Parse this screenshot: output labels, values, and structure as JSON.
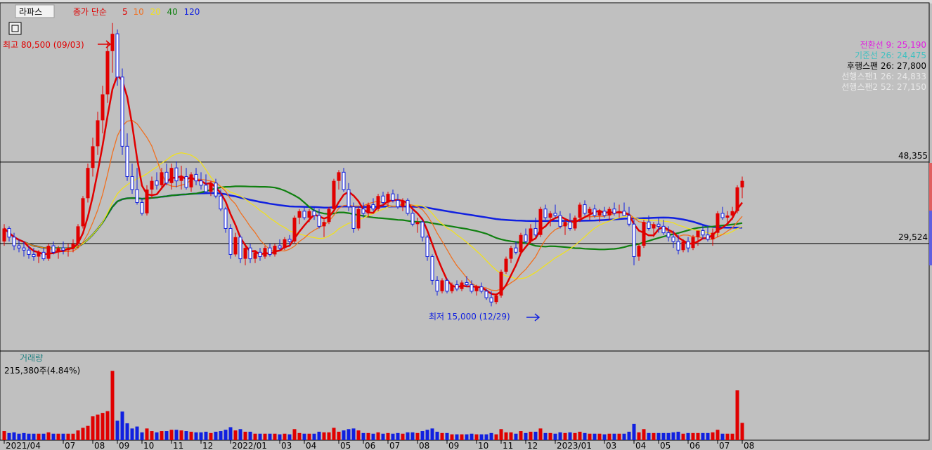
{
  "header": {
    "stock_name": "라파스",
    "ma_prefix": "종가 단순",
    "ma_periods": [
      {
        "period": "5",
        "color": "#e00000"
      },
      {
        "period": "10",
        "color": "#f07020"
      },
      {
        "period": "20",
        "color": "#f0e020"
      },
      {
        "period": "40",
        "color": "#108010"
      },
      {
        "period": "120",
        "color": "#1020e0"
      }
    ]
  },
  "ichimoku": [
    {
      "label": "전환선 9: 25,190",
      "color": "#e020e0"
    },
    {
      "label": "기준선 26: 24,475",
      "color": "#40c0c0"
    },
    {
      "label": "후행스팬 26: 27,800",
      "color": "#000000"
    },
    {
      "label": "선행스팬1 26: 24,833",
      "color": "#e8e8e8"
    },
    {
      "label": "선행스팬2 52: 27,150",
      "color": "#e8e8e8"
    }
  ],
  "annotations": {
    "high_label": "최고 80,500 (09/03)",
    "low_label": "최저 15,000 (12/29)"
  },
  "volume": {
    "title": "거래량",
    "value": "215,380주(4.84%)"
  },
  "colors": {
    "up": "#e00000",
    "down": "#1020e0",
    "background": "#c0c0c0"
  },
  "chart_data": {
    "type": "candlestick",
    "price_ylim": [
      5000,
      85000
    ],
    "horizontal_lines": [
      {
        "value": 48355,
        "label": "48,355"
      },
      {
        "value": 29524,
        "label": "29,524"
      }
    ],
    "x_tick_labels": [
      {
        "index": 0,
        "label": "2021/04"
      },
      {
        "index": 12,
        "label": "07"
      },
      {
        "index": 18,
        "label": "08"
      },
      {
        "index": 23,
        "label": "09"
      },
      {
        "index": 28,
        "label": "10"
      },
      {
        "index": 34,
        "label": "11"
      },
      {
        "index": 40,
        "label": "12"
      },
      {
        "index": 46,
        "label": "2022/01"
      },
      {
        "index": 56,
        "label": "03"
      },
      {
        "index": 61,
        "label": "04"
      },
      {
        "index": 68,
        "label": "05"
      },
      {
        "index": 73,
        "label": "06"
      },
      {
        "index": 78,
        "label": "07"
      },
      {
        "index": 84,
        "label": "08"
      },
      {
        "index": 90,
        "label": "09"
      },
      {
        "index": 96,
        "label": "10"
      },
      {
        "index": 101,
        "label": "11"
      },
      {
        "index": 106,
        "label": "12"
      },
      {
        "index": 112,
        "label": "2023/01"
      },
      {
        "index": 122,
        "label": "03"
      },
      {
        "index": 128,
        "label": "04"
      },
      {
        "index": 133,
        "label": "05"
      },
      {
        "index": 139,
        "label": "06"
      },
      {
        "index": 145,
        "label": "07"
      },
      {
        "index": 150,
        "label": "08"
      }
    ],
    "candles": [
      [
        30000,
        34000,
        29000,
        33000
      ],
      [
        33000,
        33500,
        30000,
        31000
      ],
      [
        31000,
        32000,
        28000,
        29000
      ],
      [
        29000,
        30500,
        27500,
        28500
      ],
      [
        28500,
        30000,
        26500,
        28000
      ],
      [
        28000,
        29000,
        26000,
        27000
      ],
      [
        27000,
        28500,
        25500,
        26500
      ],
      [
        26500,
        28000,
        25000,
        27500
      ],
      [
        27500,
        28500,
        25500,
        26000
      ],
      [
        26000,
        29500,
        25500,
        29000
      ],
      [
        29000,
        30000,
        27000,
        27500
      ],
      [
        27500,
        29000,
        26000,
        28500
      ],
      [
        28500,
        30000,
        27000,
        28000
      ],
      [
        28000,
        29500,
        26500,
        28500
      ],
      [
        28500,
        30500,
        27500,
        29500
      ],
      [
        29500,
        34000,
        28500,
        33500
      ],
      [
        33500,
        40500,
        33000,
        40000
      ],
      [
        40000,
        48000,
        39000,
        47000
      ],
      [
        47000,
        54000,
        45000,
        52000
      ],
      [
        52000,
        60000,
        50000,
        58000
      ],
      [
        58000,
        66000,
        55000,
        64000
      ],
      [
        64000,
        76000,
        62000,
        74000
      ],
      [
        74000,
        80500,
        69000,
        78000
      ],
      [
        78000,
        79000,
        66000,
        68000
      ],
      [
        68000,
        70000,
        50000,
        52000
      ],
      [
        52000,
        55000,
        44000,
        45000
      ],
      [
        45000,
        48000,
        41000,
        42000
      ],
      [
        42000,
        47000,
        38500,
        39000
      ],
      [
        39000,
        40000,
        36000,
        36500
      ],
      [
        36500,
        43000,
        36000,
        42000
      ],
      [
        42000,
        45000,
        40000,
        44000
      ],
      [
        44000,
        46000,
        42000,
        43000
      ],
      [
        43000,
        47000,
        42000,
        46000
      ],
      [
        46000,
        48000,
        43000,
        43500
      ],
      [
        43500,
        48000,
        42000,
        47000
      ],
      [
        47000,
        48500,
        42500,
        44000
      ],
      [
        44000,
        47500,
        42000,
        45000
      ],
      [
        45000,
        47000,
        42000,
        42500
      ],
      [
        42500,
        46000,
        41500,
        45500
      ],
      [
        45500,
        47000,
        43000,
        44000
      ],
      [
        44000,
        46000,
        42000,
        43000
      ],
      [
        43000,
        45500,
        41000,
        41500
      ],
      [
        41500,
        44000,
        40500,
        43500
      ],
      [
        43500,
        44500,
        40000,
        40500
      ],
      [
        40500,
        42000,
        37000,
        37500
      ],
      [
        37500,
        38000,
        32000,
        33000
      ],
      [
        33000,
        34000,
        26000,
        27000
      ],
      [
        27000,
        32000,
        26500,
        31000
      ],
      [
        31000,
        31500,
        25000,
        26000
      ],
      [
        26000,
        29000,
        24500,
        28500
      ],
      [
        28500,
        29500,
        25000,
        26000
      ],
      [
        26000,
        28000,
        25000,
        27500
      ],
      [
        27500,
        28500,
        25500,
        26500
      ],
      [
        26500,
        29000,
        26000,
        28500
      ],
      [
        28500,
        29500,
        26500,
        27000
      ],
      [
        27000,
        29500,
        26500,
        29000
      ],
      [
        29000,
        30500,
        28000,
        28500
      ],
      [
        28500,
        31000,
        28000,
        30500
      ],
      [
        30500,
        31500,
        29000,
        30000
      ],
      [
        30000,
        36000,
        29500,
        35500
      ],
      [
        35500,
        37500,
        34000,
        37000
      ],
      [
        37000,
        38000,
        35000,
        35500
      ],
      [
        35500,
        37500,
        34500,
        37000
      ],
      [
        37000,
        38000,
        35000,
        36000
      ],
      [
        36000,
        37500,
        33000,
        33500
      ],
      [
        33500,
        35000,
        31000,
        34500
      ],
      [
        34500,
        38000,
        34000,
        37500
      ],
      [
        37500,
        44500,
        37000,
        44000
      ],
      [
        44000,
        46500,
        42000,
        46000
      ],
      [
        46000,
        47000,
        41500,
        42000
      ],
      [
        42000,
        43500,
        37000,
        38000
      ],
      [
        38000,
        39000,
        32000,
        33000
      ],
      [
        33000,
        38000,
        32500,
        37500
      ],
      [
        37500,
        39000,
        35500,
        36500
      ],
      [
        36500,
        39000,
        35500,
        38500
      ],
      [
        38500,
        40000,
        37000,
        37500
      ],
      [
        37500,
        41000,
        37000,
        40500
      ],
      [
        40500,
        41500,
        38500,
        39000
      ],
      [
        39000,
        41500,
        38000,
        41000
      ],
      [
        41000,
        42000,
        39000,
        39500
      ],
      [
        39500,
        41000,
        37500,
        38000
      ],
      [
        38000,
        40000,
        37000,
        39500
      ],
      [
        39500,
        40000,
        36000,
        36500
      ],
      [
        36500,
        37500,
        33500,
        34000
      ],
      [
        34000,
        35500,
        32000,
        34500
      ],
      [
        34500,
        35000,
        30000,
        31000
      ],
      [
        31000,
        31500,
        25500,
        26500
      ],
      [
        26500,
        27000,
        20000,
        21000
      ],
      [
        21000,
        22000,
        17500,
        18500
      ],
      [
        18500,
        21500,
        18000,
        21000
      ],
      [
        21000,
        21500,
        18000,
        18500
      ],
      [
        18500,
        20500,
        18000,
        20000
      ],
      [
        20000,
        21000,
        18500,
        19000
      ],
      [
        19000,
        21000,
        18500,
        20500
      ],
      [
        20500,
        22000,
        19500,
        20000
      ],
      [
        20000,
        21000,
        18000,
        18500
      ],
      [
        18500,
        20000,
        17500,
        19500
      ],
      [
        19500,
        20500,
        18000,
        18500
      ],
      [
        18500,
        19000,
        16500,
        17000
      ],
      [
        17000,
        18500,
        15000,
        16000
      ],
      [
        16000,
        18000,
        15500,
        17500
      ],
      [
        17500,
        23500,
        17000,
        23000
      ],
      [
        23000,
        26500,
        22500,
        26000
      ],
      [
        26000,
        29000,
        25000,
        28500
      ],
      [
        28500,
        30000,
        27000,
        27500
      ],
      [
        27500,
        32000,
        27000,
        31500
      ],
      [
        31500,
        33000,
        29500,
        30000
      ],
      [
        30000,
        34000,
        29500,
        33000
      ],
      [
        33000,
        35500,
        31000,
        31500
      ],
      [
        31500,
        38000,
        31000,
        37500
      ],
      [
        37500,
        38500,
        35000,
        35500
      ],
      [
        35500,
        37000,
        33500,
        36500
      ],
      [
        36500,
        38500,
        35500,
        36000
      ],
      [
        36000,
        37000,
        33000,
        33500
      ],
      [
        33500,
        35000,
        31500,
        34500
      ],
      [
        34500,
        36500,
        32500,
        33000
      ],
      [
        33000,
        36000,
        32500,
        35500
      ],
      [
        35500,
        39000,
        34500,
        38500
      ],
      [
        38500,
        39500,
        36000,
        36500
      ],
      [
        36500,
        38000,
        35000,
        37500
      ],
      [
        37500,
        38500,
        35500,
        36000
      ],
      [
        36000,
        37500,
        34500,
        37000
      ],
      [
        37000,
        38000,
        35500,
        36000
      ],
      [
        36000,
        38000,
        35000,
        37500
      ],
      [
        37500,
        39000,
        36000,
        36500
      ],
      [
        36500,
        38500,
        35500,
        37000
      ],
      [
        37000,
        39000,
        36000,
        36000
      ],
      [
        36000,
        38000,
        33500,
        34000
      ],
      [
        34000,
        35000,
        24500,
        26500
      ],
      [
        26500,
        29500,
        25500,
        29000
      ],
      [
        29000,
        35000,
        28500,
        34500
      ],
      [
        34500,
        36000,
        32500,
        33000
      ],
      [
        33000,
        34500,
        31000,
        34000
      ],
      [
        34000,
        35500,
        32000,
        33500
      ],
      [
        33500,
        35000,
        31500,
        32000
      ],
      [
        32000,
        33500,
        30000,
        31000
      ],
      [
        31000,
        32500,
        28500,
        30000
      ],
      [
        30000,
        31500,
        27000,
        28000
      ],
      [
        28000,
        30500,
        27500,
        30000
      ],
      [
        30000,
        31000,
        27500,
        28500
      ],
      [
        28500,
        31500,
        28000,
        31000
      ],
      [
        31000,
        32500,
        29000,
        32500
      ],
      [
        32500,
        34000,
        30500,
        31500
      ],
      [
        31500,
        33500,
        30000,
        30500
      ],
      [
        30500,
        33000,
        29000,
        32000
      ],
      [
        32000,
        37000,
        31000,
        36500
      ],
      [
        36500,
        38000,
        35000,
        35500
      ],
      [
        35500,
        37000,
        34000,
        36000
      ],
      [
        36000,
        38000,
        35000,
        37000
      ],
      [
        37000,
        43000,
        36500,
        42500
      ],
      [
        42500,
        45000,
        40000,
        44000
      ]
    ],
    "series": [
      {
        "name": "5",
        "color": "#e00000"
      },
      {
        "name": "10",
        "color": "#f07020"
      },
      {
        "name": "20",
        "color": "#f0e020"
      },
      {
        "name": "40",
        "color": "#108010"
      },
      {
        "name": "120",
        "color": "#1020e0"
      }
    ],
    "volume_ylim": [
      0,
      350000
    ]
  }
}
